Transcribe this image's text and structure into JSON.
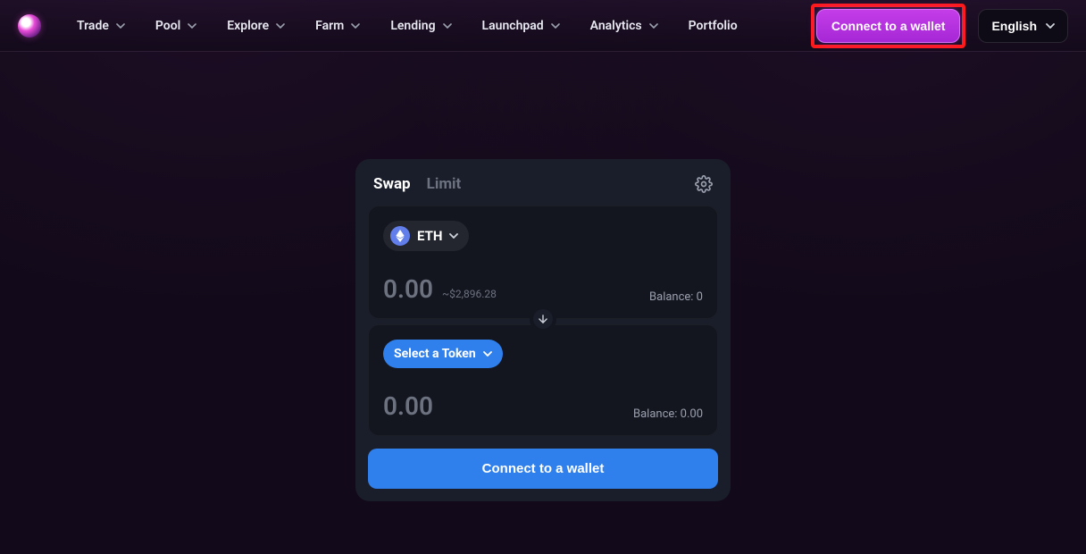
{
  "nav": {
    "items": [
      {
        "label": "Trade",
        "has_chevron": true
      },
      {
        "label": "Pool",
        "has_chevron": true
      },
      {
        "label": "Explore",
        "has_chevron": true
      },
      {
        "label": "Farm",
        "has_chevron": true
      },
      {
        "label": "Lending",
        "has_chevron": true
      },
      {
        "label": "Launchpad",
        "has_chevron": true
      },
      {
        "label": "Analytics",
        "has_chevron": true
      },
      {
        "label": "Portfolio",
        "has_chevron": false
      }
    ]
  },
  "header": {
    "connect_label": "Connect to a wallet",
    "language_label": "English"
  },
  "swap": {
    "tabs": {
      "swap": "Swap",
      "limit": "Limit"
    },
    "from": {
      "token_symbol": "ETH",
      "amount": "0.00",
      "usd": "~$2,896.28",
      "balance_label": "Balance: 0"
    },
    "to": {
      "select_label": "Select a Token",
      "amount": "0.00",
      "balance_label": "Balance: 0.00"
    },
    "action_label": "Connect to a wallet"
  }
}
